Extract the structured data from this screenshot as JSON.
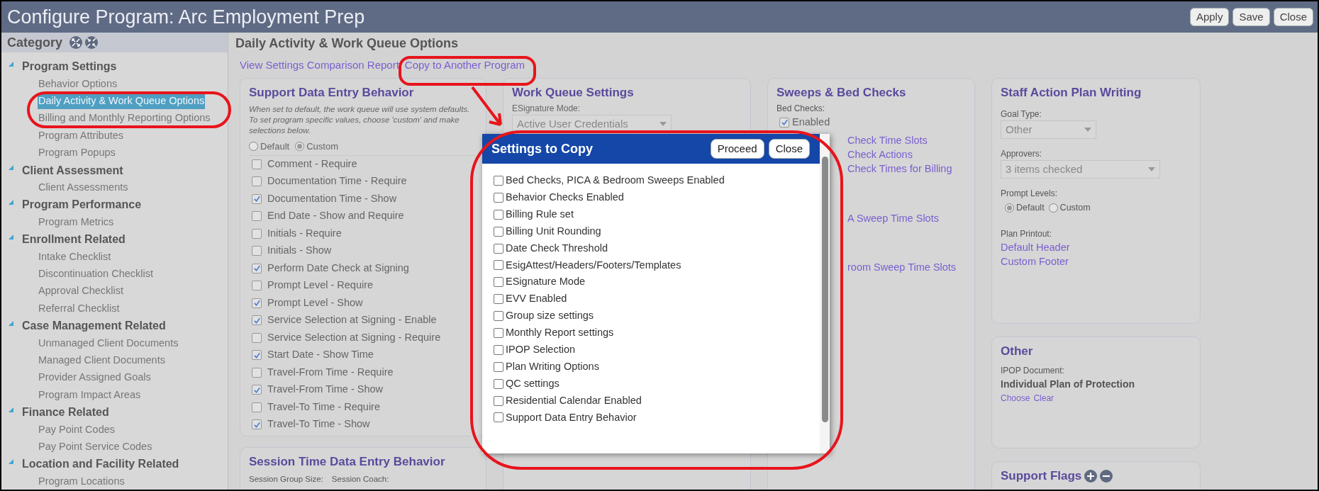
{
  "window": {
    "title": "Configure Program: Arc Employment Prep",
    "buttons": [
      "Apply",
      "Save",
      "Close"
    ]
  },
  "sidebar": {
    "title": "Category",
    "groups": [
      {
        "label": "Program Settings",
        "expanded": true,
        "items": [
          {
            "label": "Behavior Options",
            "selected": false
          },
          {
            "label": "Daily Activity & Work Queue Options",
            "selected": true
          },
          {
            "label": "Billing and Monthly Reporting Options",
            "selected": false
          },
          {
            "label": "Program Attributes",
            "selected": false
          },
          {
            "label": "Program Popups",
            "selected": false
          }
        ]
      },
      {
        "label": "Client Assessment",
        "expanded": true,
        "items": [
          {
            "label": "Client Assessments",
            "selected": false
          }
        ]
      },
      {
        "label": "Program Performance",
        "expanded": true,
        "items": [
          {
            "label": "Program Metrics",
            "selected": false
          }
        ]
      },
      {
        "label": "Enrollment Related",
        "expanded": true,
        "items": [
          {
            "label": "Intake Checklist",
            "selected": false
          },
          {
            "label": "Discontinuation Checklist",
            "selected": false
          },
          {
            "label": "Approval Checklist",
            "selected": false
          },
          {
            "label": "Referral Checklist",
            "selected": false
          }
        ]
      },
      {
        "label": "Case Management Related",
        "expanded": true,
        "items": [
          {
            "label": "Unmanaged Client Documents",
            "selected": false
          },
          {
            "label": "Managed Client Documents",
            "selected": false
          },
          {
            "label": "Provider Assigned Goals",
            "selected": false
          },
          {
            "label": "Program Impact Areas",
            "selected": false
          }
        ]
      },
      {
        "label": "Finance Related",
        "expanded": true,
        "items": [
          {
            "label": "Pay Point Codes",
            "selected": false
          },
          {
            "label": "Pay Point Service Codes",
            "selected": false
          }
        ]
      },
      {
        "label": "Location and Facility Related",
        "expanded": true,
        "items": [
          {
            "label": "Program Locations",
            "selected": false
          }
        ]
      }
    ]
  },
  "main": {
    "heading": "Daily Activity & Work Queue Options",
    "links": [
      "View Settings Comparison Report",
      "Copy to Another Program"
    ]
  },
  "support_data_entry": {
    "title": "Support Data Entry Behavior",
    "description": "When set to default, the work queue will use system defaults. To set program specific values, choose 'custom' and make selections below.",
    "modes": [
      {
        "label": "Default",
        "selected": false
      },
      {
        "label": "Custom",
        "selected": true
      }
    ],
    "options": [
      {
        "label": "Comment - Require",
        "checked": false
      },
      {
        "label": "Documentation Time - Require",
        "checked": false
      },
      {
        "label": "Documentation Time - Show",
        "checked": true
      },
      {
        "label": "End Date - Show and Require",
        "checked": false
      },
      {
        "label": "Initials - Require",
        "checked": false
      },
      {
        "label": "Initials - Show",
        "checked": false
      },
      {
        "label": "Perform Date Check at Signing",
        "checked": true
      },
      {
        "label": "Prompt Level - Require",
        "checked": false
      },
      {
        "label": "Prompt Level - Show",
        "checked": true
      },
      {
        "label": "Service Selection at Signing - Enable",
        "checked": true
      },
      {
        "label": "Service Selection at Signing - Require",
        "checked": false
      },
      {
        "label": "Start Date - Show Time",
        "checked": true
      },
      {
        "label": "Travel-From Time - Require",
        "checked": false
      },
      {
        "label": "Travel-From Time - Show",
        "checked": true
      },
      {
        "label": "Travel-To Time - Require",
        "checked": false
      },
      {
        "label": "Travel-To Time - Show",
        "checked": true
      }
    ]
  },
  "session_time": {
    "title": "Session Time Data Entry Behavior",
    "labels": [
      "Session Group Size:",
      "Session Coach:"
    ]
  },
  "work_queue_settings": {
    "title": "Work Queue Settings",
    "esignature_label": "ESignature Mode:",
    "esignature_value": "Active User Credentials"
  },
  "sweeps": {
    "title": "Sweeps & Bed Checks",
    "bed_checks_label": "Bed Checks:",
    "bed_checks": {
      "label": "Enabled",
      "checked": true
    },
    "links": [
      "Check Time Slots",
      "Check Actions",
      "Check Times for Billing",
      "A Sweep Time Slots",
      "room Sweep Time Slots"
    ]
  },
  "staff_action_plan": {
    "title": "Staff Action Plan Writing",
    "goal_type_label": "Goal Type:",
    "goal_type": "Other",
    "approvers_label": "Approvers:",
    "approvers": "3 items checked",
    "prompt_levels_label": "Prompt Levels:",
    "prompt_levels": [
      {
        "label": "Default",
        "selected": true
      },
      {
        "label": "Custom",
        "selected": false
      }
    ],
    "plan_printout_label": "Plan Printout:",
    "plan_printout_links": [
      "Default Header",
      "Custom Footer"
    ]
  },
  "other": {
    "title": "Other",
    "ipop_label": "IPOP Document:",
    "ipop_value": "Individual Plan of Protection",
    "links": [
      "Choose",
      "Clear"
    ]
  },
  "support_flags": {
    "title": "Support Flags"
  },
  "dialog": {
    "title": "Settings to Copy",
    "buttons": [
      "Proceed",
      "Close"
    ],
    "items": [
      {
        "label": "Bed Checks, PICA & Bedroom Sweeps Enabled",
        "checked": false
      },
      {
        "label": "Behavior Checks Enabled",
        "checked": false
      },
      {
        "label": "Billing Rule set",
        "checked": false
      },
      {
        "label": "Billing Unit Rounding",
        "checked": false
      },
      {
        "label": "Date Check Threshold",
        "checked": false
      },
      {
        "label": "EsigAttest/Headers/Footers/Templates",
        "checked": false
      },
      {
        "label": "ESignature Mode",
        "checked": false
      },
      {
        "label": "EVV Enabled",
        "checked": false
      },
      {
        "label": "Group size settings",
        "checked": false
      },
      {
        "label": "Monthly Report settings",
        "checked": false
      },
      {
        "label": "IPOP Selection",
        "checked": false
      },
      {
        "label": "Plan Writing Options",
        "checked": false
      },
      {
        "label": "QC settings",
        "checked": false
      },
      {
        "label": "Residential Calendar Enabled",
        "checked": false
      },
      {
        "label": "Support Data Entry Behavior",
        "checked": false
      }
    ]
  }
}
